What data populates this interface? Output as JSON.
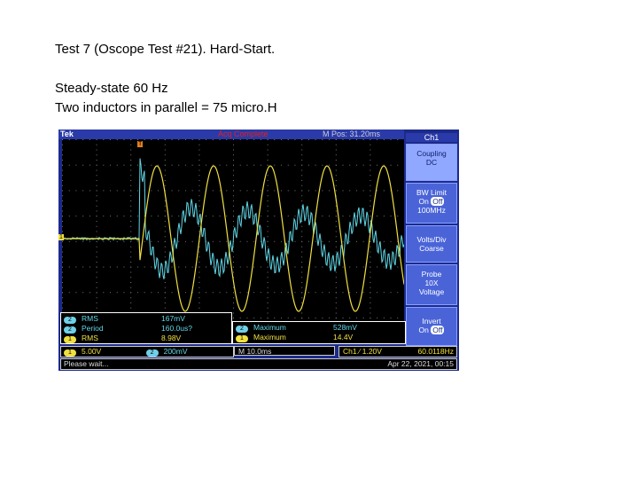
{
  "slide": {
    "title": "Test 7 (Oscope Test #21).  Hard-Start.",
    "line2": "Steady-state 60 Hz",
    "line3": "Two inductors in parallel = 75 micro.H"
  },
  "scope": {
    "brand": "Tek",
    "trigger_state": "Acq Complete",
    "mpos": "M Pos: 31.20ms",
    "trigger_marker": "T",
    "ch1_marker": "1",
    "menu": {
      "title": "Ch1",
      "buttons": [
        {
          "l1": "Coupling",
          "l2": "DC"
        },
        {
          "l1": "BW Limit",
          "on": "On",
          "off": "Off",
          "l3": "100MHz"
        },
        {
          "l1": "Volts/Div",
          "l2": "Coarse"
        },
        {
          "l1": "Probe",
          "l2": "10X",
          "l3": "Voltage"
        },
        {
          "l1": "Invert",
          "on": "On",
          "off": "Off"
        }
      ]
    },
    "measurements_left": [
      {
        "ch": "2",
        "name": "RMS",
        "value": "167mV"
      },
      {
        "ch": "2",
        "name": "Period",
        "value": "160.0us?"
      },
      {
        "ch": "1",
        "name": "RMS",
        "value": "8.98V"
      }
    ],
    "measurements_right": [
      {
        "ch": "2",
        "name": "Maximum",
        "value": "528mV"
      },
      {
        "ch": "1",
        "name": "Maximum",
        "value": "14.4V"
      }
    ],
    "status": {
      "ch1": "1",
      "ch1_scale": "5.00V",
      "ch2": "2",
      "ch2_scale": "200mV",
      "timebase": "M 10.0ms",
      "trigger": "Ch1 ∕ 1.20V",
      "freq": "60.0118Hz",
      "message": "Please wait...",
      "datetime": "Apr 22, 2021, 00:15"
    },
    "colors": {
      "ch1": "#f0e040",
      "ch2": "#60d8e8"
    }
  }
}
